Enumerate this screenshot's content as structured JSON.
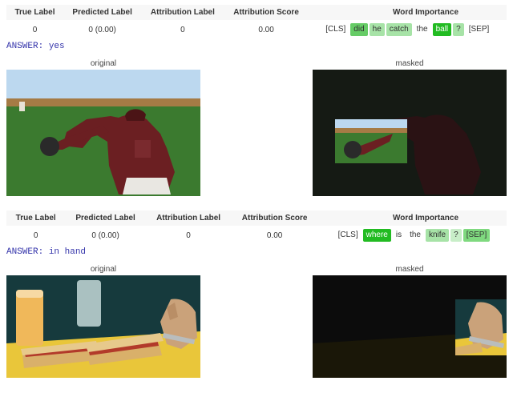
{
  "example1": {
    "headers": [
      "True Label",
      "Predicted Label",
      "Attribution Label",
      "Attribution Score",
      "Word Importance"
    ],
    "true_label": "0",
    "predicted_label": "0 (0.00)",
    "attribution_label": "0",
    "attribution_score": "0.00",
    "tokens": [
      {
        "text": "[CLS]",
        "bg": "#ffffff"
      },
      {
        "text": "did",
        "bg": "#66cc66"
      },
      {
        "text": "he",
        "bg": "#a7e3a7"
      },
      {
        "text": "catch",
        "bg": "#a7e3a7"
      },
      {
        "text": "the",
        "bg": "#ffffff"
      },
      {
        "text": "ball",
        "bg": "#22bb22",
        "fg": "#ffffff"
      },
      {
        "text": "?",
        "bg": "#a7e3a7"
      },
      {
        "text": "[SEP]",
        "bg": "#ffffff"
      }
    ],
    "answer_label": "ANSWER:",
    "answer": "yes",
    "panel_orig": "original",
    "panel_mask": "masked"
  },
  "example2": {
    "true_label": "0",
    "predicted_label": "0 (0.00)",
    "attribution_label": "0",
    "attribution_score": "0.00",
    "tokens": [
      {
        "text": "[CLS]",
        "bg": "#ffffff"
      },
      {
        "text": "where",
        "bg": "#22bb22",
        "fg": "#ffffff"
      },
      {
        "text": "is",
        "bg": "#ffffff"
      },
      {
        "text": "the",
        "bg": "#ffffff"
      },
      {
        "text": "knife",
        "bg": "#a7e3a7"
      },
      {
        "text": "?",
        "bg": "#c8eec8"
      },
      {
        "text": "[SEP]",
        "bg": "#7fd97f"
      }
    ],
    "answer_label": "ANSWER:",
    "answer": "in hand",
    "panel_orig": "original",
    "panel_mask": "masked"
  }
}
